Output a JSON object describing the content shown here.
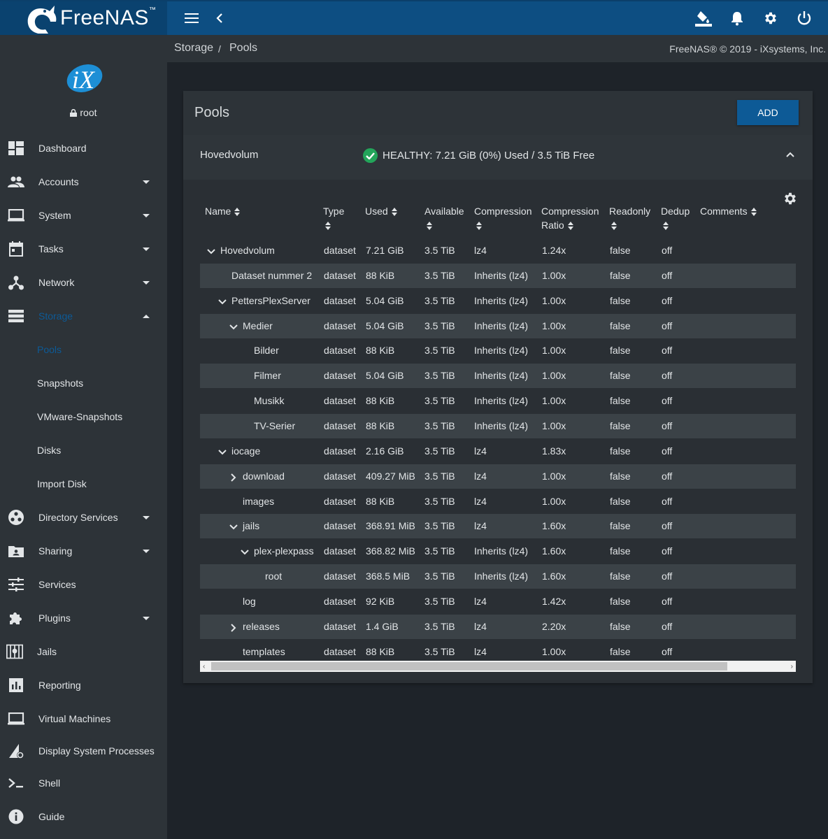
{
  "topbar": {
    "brand": "FreeNAS",
    "brand_mark": "™"
  },
  "sidebar": {
    "user": "root",
    "items": [
      {
        "label": "Dashboard",
        "icon": "dashboard-icon",
        "expandable": false
      },
      {
        "label": "Accounts",
        "icon": "people-icon",
        "expandable": true
      },
      {
        "label": "System",
        "icon": "laptop-icon",
        "expandable": true
      },
      {
        "label": "Tasks",
        "icon": "calendar-icon",
        "expandable": true
      },
      {
        "label": "Network",
        "icon": "network-icon",
        "expandable": true
      },
      {
        "label": "Storage",
        "icon": "storage-icon",
        "expandable": true,
        "expanded": true,
        "active": true
      }
    ],
    "storage_sub": [
      "Pools",
      "Snapshots",
      "VMware-Snapshots",
      "Disks",
      "Import Disk"
    ],
    "items_after": [
      {
        "label": "Directory Services",
        "icon": "directory-icon",
        "expandable": true
      },
      {
        "label": "Sharing",
        "icon": "folder-share-icon",
        "expandable": true
      },
      {
        "label": "Services",
        "icon": "tune-icon",
        "expandable": false
      },
      {
        "label": "Plugins",
        "icon": "puzzle-icon",
        "expandable": true
      },
      {
        "label": "Jails",
        "icon": "jail-icon",
        "expandable": false
      },
      {
        "label": "Reporting",
        "icon": "chart-icon",
        "expandable": false
      },
      {
        "label": "Virtual Machines",
        "icon": "monitor-icon",
        "expandable": false
      },
      {
        "label": "Display System Processes",
        "icon": "processes-icon",
        "expandable": false
      },
      {
        "label": "Shell",
        "icon": "terminal-icon",
        "expandable": false
      },
      {
        "label": "Guide",
        "icon": "info-icon",
        "expandable": false
      }
    ]
  },
  "breadcrumb": {
    "parent": "Storage",
    "separator": "/",
    "current": "Pools"
  },
  "copyright": "FreeNAS® © 2019 - iXsystems, Inc.",
  "card": {
    "title": "Pools",
    "add_label": "ADD"
  },
  "pool": {
    "name": "Hovedvolum",
    "status": "HEALTHY: 7.21 GiB (0%) Used / 3.5 TiB Free"
  },
  "table": {
    "columns": [
      {
        "label": "Name"
      },
      {
        "label": "Type"
      },
      {
        "label": "Used"
      },
      {
        "label": "Available"
      },
      {
        "label": "Compression"
      },
      {
        "label": "Compression Ratio"
      },
      {
        "label": "Readonly"
      },
      {
        "label": "Dedup"
      },
      {
        "label": "Comments"
      }
    ],
    "rows": [
      {
        "name": "Hovedvolum",
        "level": 0,
        "expander": "down",
        "type": "dataset",
        "used": "7.21 GiB",
        "available": "3.5 TiB",
        "compression": "lz4",
        "ratio": "1.24x",
        "readonly": "false",
        "dedup": "off"
      },
      {
        "name": "Dataset nummer 2",
        "level": 1,
        "expander": "none",
        "type": "dataset",
        "used": "88 KiB",
        "available": "3.5 TiB",
        "compression": "Inherits (lz4)",
        "ratio": "1.00x",
        "readonly": "false",
        "dedup": "off"
      },
      {
        "name": "PettersPlexServer",
        "level": 1,
        "expander": "down",
        "type": "dataset",
        "used": "5.04 GiB",
        "available": "3.5 TiB",
        "compression": "Inherits (lz4)",
        "ratio": "1.00x",
        "readonly": "false",
        "dedup": "off"
      },
      {
        "name": "Medier",
        "level": 2,
        "expander": "down",
        "type": "dataset",
        "used": "5.04 GiB",
        "available": "3.5 TiB",
        "compression": "Inherits (lz4)",
        "ratio": "1.00x",
        "readonly": "false",
        "dedup": "off"
      },
      {
        "name": "Bilder",
        "level": 3,
        "expander": "none",
        "type": "dataset",
        "used": "88 KiB",
        "available": "3.5 TiB",
        "compression": "Inherits (lz4)",
        "ratio": "1.00x",
        "readonly": "false",
        "dedup": "off"
      },
      {
        "name": "Filmer",
        "level": 3,
        "expander": "none",
        "type": "dataset",
        "used": "5.04 GiB",
        "available": "3.5 TiB",
        "compression": "Inherits (lz4)",
        "ratio": "1.00x",
        "readonly": "false",
        "dedup": "off"
      },
      {
        "name": "Musikk",
        "level": 3,
        "expander": "none",
        "type": "dataset",
        "used": "88 KiB",
        "available": "3.5 TiB",
        "compression": "Inherits (lz4)",
        "ratio": "1.00x",
        "readonly": "false",
        "dedup": "off"
      },
      {
        "name": "TV-Serier",
        "level": 3,
        "expander": "none",
        "type": "dataset",
        "used": "88 KiB",
        "available": "3.5 TiB",
        "compression": "Inherits (lz4)",
        "ratio": "1.00x",
        "readonly": "false",
        "dedup": "off"
      },
      {
        "name": "iocage",
        "level": 1,
        "expander": "down",
        "type": "dataset",
        "used": "2.16 GiB",
        "available": "3.5 TiB",
        "compression": "lz4",
        "ratio": "1.83x",
        "readonly": "false",
        "dedup": "off"
      },
      {
        "name": "download",
        "level": 2,
        "expander": "right",
        "type": "dataset",
        "used": "409.27 MiB",
        "available": "3.5 TiB",
        "compression": "lz4",
        "ratio": "1.00x",
        "readonly": "false",
        "dedup": "off"
      },
      {
        "name": "images",
        "level": 2,
        "expander": "none",
        "type": "dataset",
        "used": "88 KiB",
        "available": "3.5 TiB",
        "compression": "lz4",
        "ratio": "1.00x",
        "readonly": "false",
        "dedup": "off"
      },
      {
        "name": "jails",
        "level": 2,
        "expander": "down",
        "type": "dataset",
        "used": "368.91 MiB",
        "available": "3.5 TiB",
        "compression": "lz4",
        "ratio": "1.60x",
        "readonly": "false",
        "dedup": "off"
      },
      {
        "name": "plex-plexpass",
        "level": 3,
        "expander": "down",
        "type": "dataset",
        "used": "368.82 MiB",
        "available": "3.5 TiB",
        "compression": "Inherits (lz4)",
        "ratio": "1.60x",
        "readonly": "false",
        "dedup": "off"
      },
      {
        "name": "root",
        "level": 4,
        "expander": "none",
        "type": "dataset",
        "used": "368.5 MiB",
        "available": "3.5 TiB",
        "compression": "Inherits (lz4)",
        "ratio": "1.60x",
        "readonly": "false",
        "dedup": "off"
      },
      {
        "name": "log",
        "level": 2,
        "expander": "none",
        "type": "dataset",
        "used": "92 KiB",
        "available": "3.5 TiB",
        "compression": "lz4",
        "ratio": "1.42x",
        "readonly": "false",
        "dedup": "off"
      },
      {
        "name": "releases",
        "level": 2,
        "expander": "right",
        "type": "dataset",
        "used": "1.4 GiB",
        "available": "3.5 TiB",
        "compression": "lz4",
        "ratio": "2.20x",
        "readonly": "false",
        "dedup": "off"
      },
      {
        "name": "templates",
        "level": 2,
        "expander": "none",
        "type": "dataset",
        "used": "88 KiB",
        "available": "3.5 TiB",
        "compression": "lz4",
        "ratio": "1.00x",
        "readonly": "false",
        "dedup": "off"
      }
    ]
  },
  "colors": {
    "topbar": "#0d4e82",
    "sidebar": "#2d3338",
    "accent": "#0d5a96",
    "healthy": "#23a55a"
  }
}
